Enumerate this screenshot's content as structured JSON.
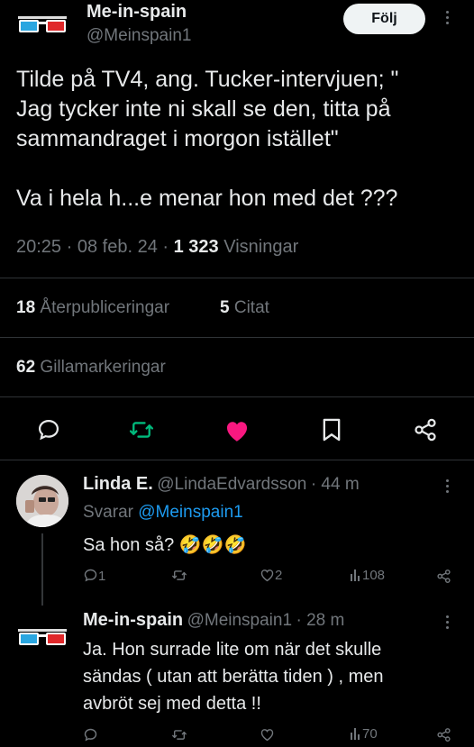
{
  "main_tweet": {
    "author_name": "Me-in-spain",
    "author_handle": "@Meinspain1",
    "follow_label": "Följ",
    "text_line1": "Tilde på TV4, ang. Tucker-intervjuen;  \"",
    "text_line2": "Jag tycker inte ni skall se den, titta på",
    "text_line3": "sammandraget i morgon istället\"",
    "text_line4": "Va i hela h...e menar hon med det ???",
    "time": "20:25",
    "sep1": "·",
    "date": "08 feb. 24",
    "sep2": "·",
    "views_count": "1 323",
    "views_label": "Visningar",
    "reposts_count": "18",
    "reposts_label": "Återpubliceringar",
    "quotes_count": "5",
    "quotes_label": "Citat",
    "likes_count": "62",
    "likes_label": "Gillamarkeringar"
  },
  "reply1": {
    "author_name": "Linda E.",
    "author_handle": "@LindaEdvardsson",
    "meta": "· 44 m",
    "replying_prefix": "Svarar",
    "replying_to": "@Meinspain1",
    "text": "Sa hon så? 🤣🤣🤣",
    "comments": "1",
    "likes": "2",
    "views": "108"
  },
  "reply2": {
    "author_name": "Me-in-spain",
    "author_handle": "@Meinspain1",
    "meta": "· 28 m",
    "text_line1": "Ja. Hon surrade lite om när det skulle",
    "text_line2": "sändas ( utan att berätta tiden ) , men",
    "text_line3": "avbröt sej med detta !!",
    "views": "70"
  },
  "colors": {
    "background": "#000000",
    "text": "#e7e9ea",
    "muted": "#71767b",
    "link": "#1d9bf0",
    "repost_green": "#00ba7c",
    "like_pink": "#f91880",
    "divider": "#2f3336"
  },
  "icons": [
    "3d-glasses-icon",
    "more-options-icon",
    "reply-icon",
    "repost-icon",
    "like-heart-icon",
    "bookmark-icon",
    "share-icon",
    "views-icon"
  ]
}
